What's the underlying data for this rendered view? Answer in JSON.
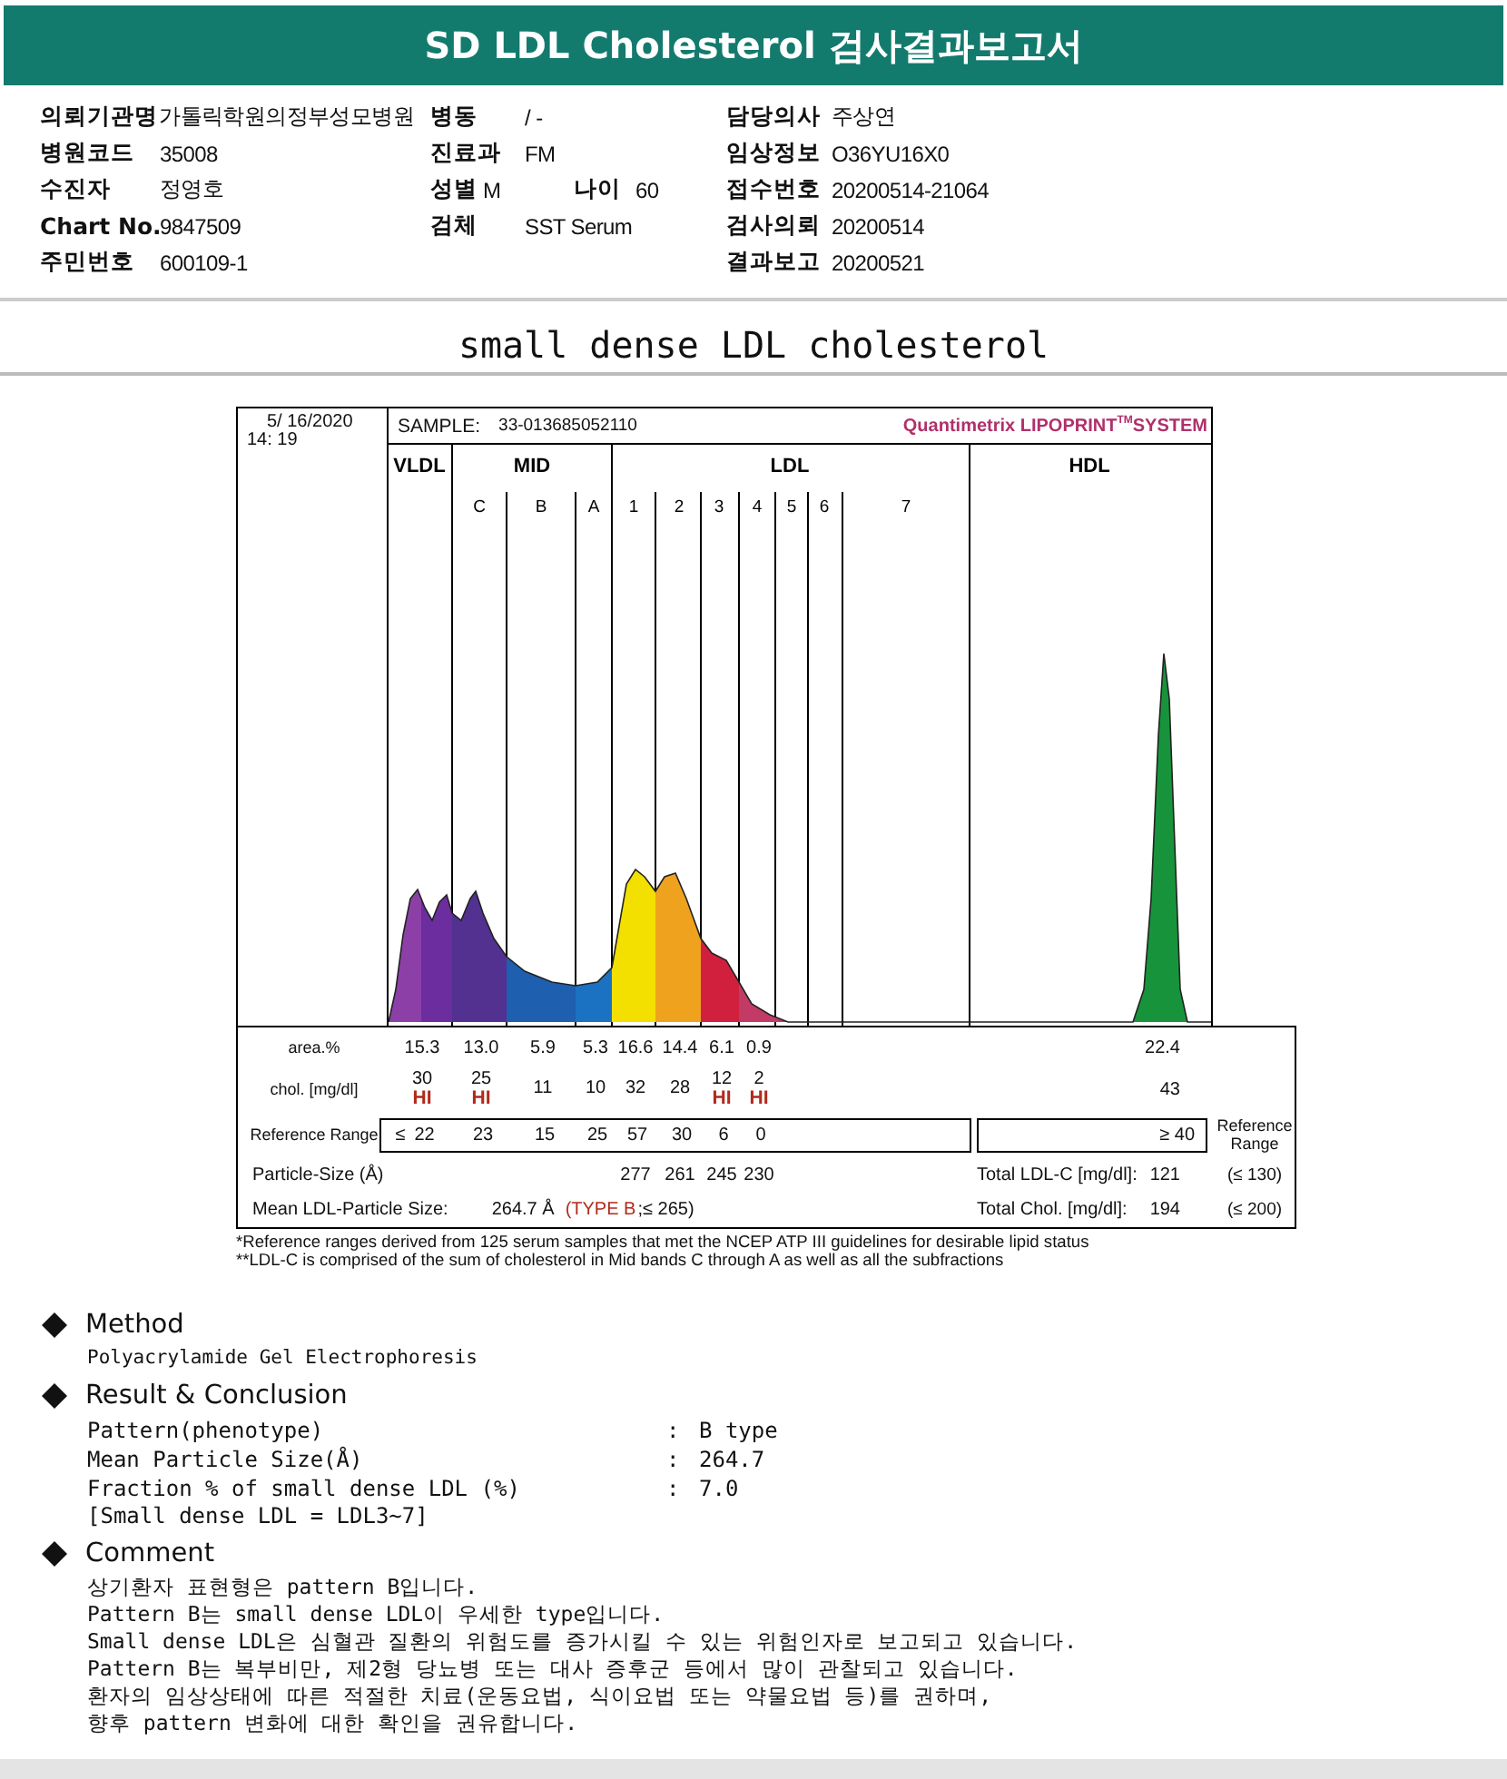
{
  "title": "SD LDL Cholesterol 검사결과보고서",
  "info": [
    {
      "left": {
        "label": "의뢰기관명",
        "value": "가톨릭학원의정부성모병원"
      },
      "middle": [
        {
          "label": "병동",
          "value": "/ -"
        }
      ],
      "right": {
        "label": "담당의사",
        "value": "주상연"
      }
    },
    {
      "left": {
        "label": "병원코드",
        "value": "35008"
      },
      "middle": [
        {
          "label": "진료과",
          "value": "FM"
        }
      ],
      "right": {
        "label": "임상정보",
        "value": "O36YU16X0"
      }
    },
    {
      "left": {
        "label": "수진자",
        "value": "정영호"
      },
      "middle": [
        {
          "label": "성별",
          "value": "M"
        },
        {
          "label": "나이",
          "value": "60"
        }
      ],
      "right": {
        "label": "접수번호",
        "value": "20200514-21064"
      }
    },
    {
      "left": {
        "label": "Chart No.",
        "value": "9847509"
      },
      "middle": [
        {
          "label": "검체",
          "value": "SST Serum"
        }
      ],
      "right": {
        "label": "검사의뢰",
        "value": "20200514"
      }
    },
    {
      "left": {
        "label": "주민번호",
        "value": "600109-1"
      },
      "right": {
        "label": "결과보고",
        "value": "20200521"
      }
    }
  ],
  "section_title": "small dense LDL cholesterol",
  "chart": {
    "date": "5/ 16/2020",
    "time": "14: 19",
    "sample_label": "SAMPLE:",
    "sample_id": "33-013685052110",
    "brand": "Quantimetrix LIPOPRINT$^{TM}$SYSTEM",
    "bands": [
      {
        "label": "VLDL"
      },
      {
        "label": "MID",
        "sub": [
          "C",
          "B",
          "A"
        ]
      },
      {
        "label": "LDL",
        "sub": [
          "1",
          "2",
          "3",
          "4",
          "5",
          "6",
          "7"
        ]
      },
      {
        "label": "HDL"
      }
    ],
    "area": {
      "label": "area.%",
      "values": [
        "15.3",
        "13.0",
        "5.9",
        "5.3",
        "16.6",
        "14.4",
        "6.1",
        "0.9"
      ],
      "hdl": "22.4"
    },
    "chol": {
      "label": "chol. [mg/dl]",
      "values": [
        {
          "value": "30",
          "flag": "HI"
        },
        {
          "value": "25",
          "flag": "HI"
        },
        {
          "value": "11"
        },
        {
          "value": "10"
        },
        {
          "value": "32"
        },
        {
          "value": "28"
        },
        {
          "value": "12",
          "flag": "HI"
        },
        {
          "value": "2",
          "flag": "HI"
        }
      ],
      "hdl": "43"
    },
    "reference": {
      "label": "Reference Range",
      "prefix": "≤",
      "values": [
        "22",
        "23",
        "15",
        "25",
        "57",
        "30",
        "6",
        "0"
      ],
      "hdl": "≥ 40",
      "side_label": "Reference Range"
    },
    "particle": {
      "label": "Particle-Size (Å)",
      "values": [
        "277",
        "261",
        "245",
        "230"
      ],
      "total_label": "Total LDL-C [mg/dl]:",
      "total": "121",
      "total_range": "(≤ 130)"
    },
    "mean": {
      "label": "Mean LDL-Particle Size:",
      "value": "264.7 Å",
      "type": "(TYPE B",
      "type_range": ";≤ 265)",
      "total_label": "Total Chol. [mg/dl]:",
      "total": "194",
      "total_range": "(≤ 200)"
    }
  },
  "footnotes": [
    "*Reference ranges derived from 125 serum samples that met the NCEP ATP III guidelines for desirable lipid status",
    "**LDL-C is comprised of the sum of cholesterol in Mid bands C through A as well as all the subfractions"
  ],
  "method": {
    "heading": "Method",
    "text": "Polyacrylamide Gel Electrophoresis"
  },
  "result": {
    "heading": "Result & Conclusion",
    "items": [
      {
        "label": "Pattern(phenotype)",
        "separator": ":",
        "value": "B type"
      },
      {
        "label": "Mean Particle Size(Å)",
        "separator": ":",
        "value": "264.7"
      },
      {
        "label": "Fraction % of small dense LDL (%)",
        "separator": ":",
        "value": "7.0"
      }
    ],
    "note": "[Small dense LDL = LDL3~7]"
  },
  "comment": {
    "heading": "Comment",
    "lines": [
      "상기환자 표현형은 pattern B입니다.",
      "Pattern B는 small dense LDL이 우세한 type입니다.",
      "Small dense LDL은 심혈관 질환의 위험도를 증가시킬 수 있는 위험인자로 보고되고 있습니다.",
      "Pattern B는 복부비만, 제2형 당뇨병 또는 대사 증후군 등에서 많이 관찰되고 있습니다.",
      "환자의 임상상태에 따른 적절한 치료(운동요법, 식이요법 또는 약물요법 등)를 권하며,",
      "향후 pattern 변화에 대한 확인을 권유합니다."
    ]
  }
}
